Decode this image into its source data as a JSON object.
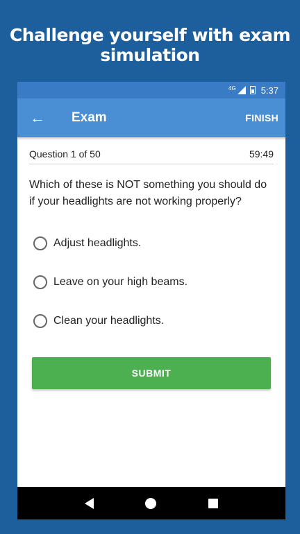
{
  "headline": "Challenge yourself with exam simulation",
  "status": {
    "network": "4G",
    "time": "5:37"
  },
  "appbar": {
    "back_icon": "←",
    "title": "Exam",
    "finish_label": "FINISH"
  },
  "quiz": {
    "progress": "Question 1 of 50",
    "timer": "59:49",
    "question": "Which of these is NOT something you should do if your headlights are not working properly?",
    "options": [
      {
        "label": "Adjust headlights."
      },
      {
        "label": "Leave on your high beams."
      },
      {
        "label": "Clean your headlights."
      }
    ],
    "submit_label": "SUBMIT"
  },
  "colors": {
    "background": "#1d5f9c",
    "statusbar": "#3a7bc6",
    "appbar": "#4a8fd4",
    "submit": "#4caf50"
  }
}
